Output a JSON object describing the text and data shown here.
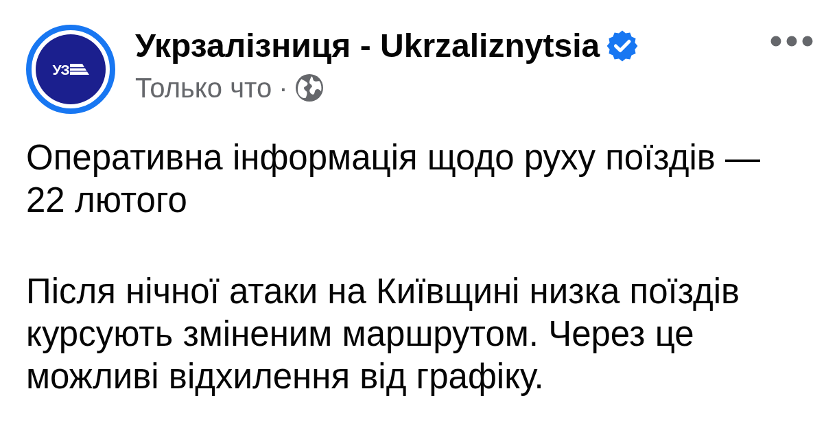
{
  "post": {
    "author": {
      "logo_text": "УЗ",
      "name": "Укрзалізниця - Ukrzaliznytsia",
      "verified": true
    },
    "meta": {
      "time": "Только что",
      "separator": "·"
    },
    "paragraphs": [
      "Оперативна інформація щодо руху поїздів — 22 лютого",
      "Після нічної атаки на Київщині низка поїздів курсують зміненим маршрутом. Через це можливі відхилення від графіку."
    ]
  }
}
